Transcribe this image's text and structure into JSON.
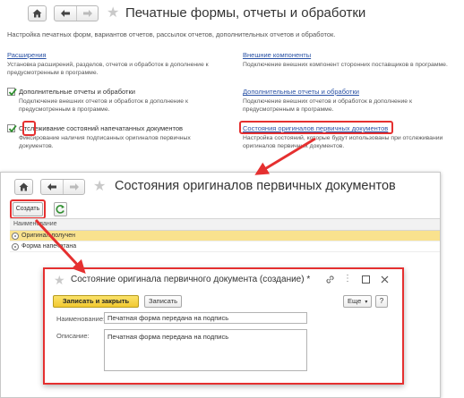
{
  "main_window": {
    "title": "Печатные формы, отчеты и обработки",
    "subtitle": "Настройка печатных форм, вариантов отчетов, рассылок отчетов, дополнительных отчетов и обработок.",
    "left_items": [
      {
        "label": "Расширения",
        "description": "Установка расширений, разделов, отчетов и обработок в дополнение к предусмотренным в программе."
      },
      {
        "label": "Дополнительные отчеты и обработки",
        "checked": true,
        "description": "Подключение внешних отчетов и обработок в дополнение к предусмотренным в программе."
      },
      {
        "label": "Отслеживание состояний напечатанных документов",
        "checked": true,
        "description": "Фиксирование наличия подписанных оригиналов первичных документов."
      }
    ],
    "right_items": [
      {
        "label": "Внешние компоненты",
        "description": "Подключение внешних компонент сторонних поставщиков в программе."
      },
      {
        "label": "Дополнительные отчеты и обработки",
        "description": "Подключение внешних отчетов и обработок в дополнение к предусмотренным в программе."
      },
      {
        "label": "Состояния оригиналов первичных документов",
        "description": "Настройка состояний, которые будут использованы при отслеживании оригиналов первичных документов."
      }
    ]
  },
  "list_window": {
    "title": "Состояния оригиналов первичных документов",
    "create_button": "Создать",
    "column_header": "Наименование",
    "rows": [
      {
        "name": "Оригинал получен",
        "selected": true
      },
      {
        "name": "Форма напечатана",
        "selected": false
      }
    ]
  },
  "dialog": {
    "title": "Состояние оригинала первичного документа (создание) *",
    "save_close_button": "Записать и закрыть",
    "save_button": "Записать",
    "more_button": "Еще",
    "help_button": "?",
    "name_label": "Наименование:",
    "name_value": "Печатная форма передана на подпись",
    "description_label": "Описание:",
    "description_value": "Печатная форма передана на подпись"
  },
  "colors": {
    "link": "#2a52a5",
    "highlight": "#e53030",
    "selected_row": "#f9e28e",
    "primary_button": "#f2c931"
  },
  "icons": [
    "home-icon",
    "back-arrow-icon",
    "forward-arrow-icon",
    "star-icon",
    "refresh-icon",
    "link-icon",
    "more-vertical-icon",
    "maximize-icon",
    "close-icon",
    "checkmark-icon",
    "state-icon"
  ]
}
